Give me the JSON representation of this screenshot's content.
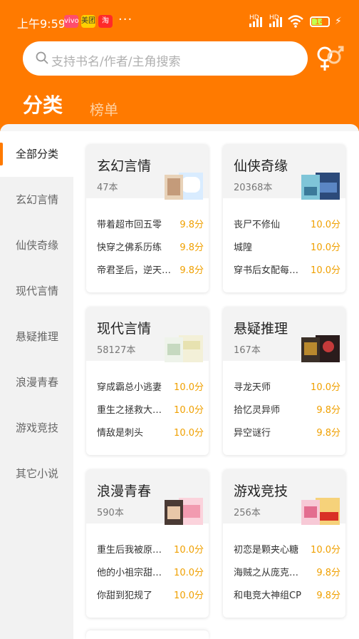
{
  "status": {
    "time": "上午9:59",
    "apps": [
      "vivo",
      "美团",
      "淘"
    ],
    "more": "···",
    "network1": "HD",
    "network2": "HD",
    "battery": "14"
  },
  "search": {
    "placeholder": "支持书名/作者/主角搜索"
  },
  "tabs": {
    "category": "分类",
    "ranking": "榜单"
  },
  "sidebar": {
    "items": [
      {
        "label": "全部分类"
      },
      {
        "label": "玄幻言情"
      },
      {
        "label": "仙侠奇缘"
      },
      {
        "label": "现代言情"
      },
      {
        "label": "悬疑推理"
      },
      {
        "label": "浪漫青春"
      },
      {
        "label": "游戏竞技"
      },
      {
        "label": "其它小说"
      }
    ]
  },
  "cards": [
    {
      "title": "玄幻言情",
      "count": "47本",
      "books": [
        {
          "title": "带着超市回五零",
          "score": "9.8分"
        },
        {
          "title": "快穿之佛系历练",
          "score": "9.8分"
        },
        {
          "title": "帝君圣后，逆天…",
          "score": "9.8分"
        }
      ]
    },
    {
      "title": "仙侠奇缘",
      "count": "20368本",
      "books": [
        {
          "title": "丧尸不修仙",
          "score": "10.0分"
        },
        {
          "title": "城隍",
          "score": "10.0分"
        },
        {
          "title": "穿书后女配每…",
          "score": "10.0分"
        }
      ]
    },
    {
      "title": "现代言情",
      "count": "58127本",
      "books": [
        {
          "title": "穿成霸总小逃妻",
          "score": "10.0分"
        },
        {
          "title": "重生之拯救大…",
          "score": "10.0分"
        },
        {
          "title": "情敌是刺头",
          "score": "10.0分"
        }
      ]
    },
    {
      "title": "悬疑推理",
      "count": "167本",
      "books": [
        {
          "title": "寻龙天师",
          "score": "10.0分"
        },
        {
          "title": "拾忆灵异师",
          "score": "9.8分"
        },
        {
          "title": "异空谜行",
          "score": "9.8分"
        }
      ]
    },
    {
      "title": "浪漫青春",
      "count": "590本",
      "books": [
        {
          "title": "重生后我被原…",
          "score": "10.0分"
        },
        {
          "title": "他的小祖宗甜…",
          "score": "10.0分"
        },
        {
          "title": "你甜到犯规了",
          "score": "10.0分"
        }
      ]
    },
    {
      "title": "游戏竞技",
      "count": "256本",
      "books": [
        {
          "title": "初恋是颗夹心糖",
          "score": "10.0分"
        },
        {
          "title": "海贼之从庞克…",
          "score": "9.8分"
        },
        {
          "title": "和电竞大神组CP",
          "score": "9.8分"
        }
      ]
    }
  ],
  "colors": {
    "accent": "#ff7a00",
    "score": "#f0a000"
  }
}
